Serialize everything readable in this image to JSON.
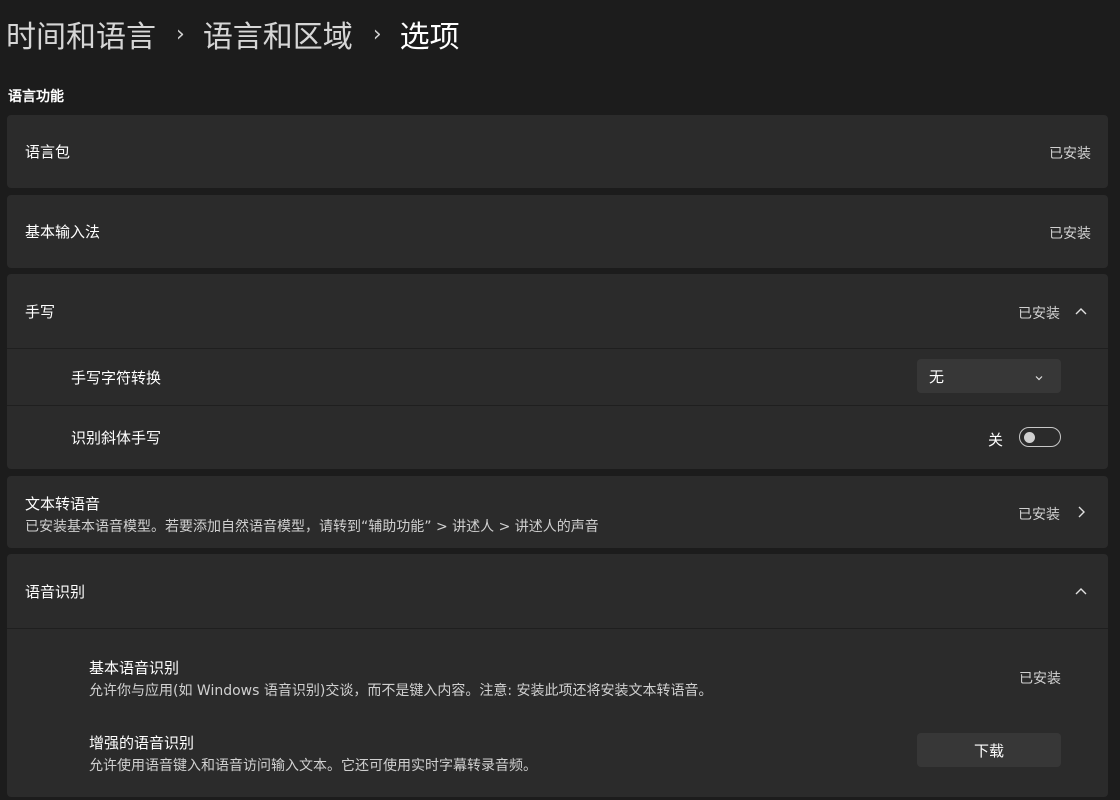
{
  "breadcrumb": {
    "items": [
      "时间和语言",
      "语言和区域",
      "选项"
    ],
    "separator": "›"
  },
  "section": {
    "title": "语言功能"
  },
  "language_pack": {
    "label": "语言包",
    "status": "已安装"
  },
  "basic_input": {
    "label": "基本输入法",
    "status": "已安装"
  },
  "handwriting": {
    "label": "手写",
    "status": "已安装",
    "expanded": true,
    "char_conversion": {
      "label": "手写字符转换",
      "selected": "无"
    },
    "cursive": {
      "label": "识别斜体手写",
      "toggle_text": "关",
      "on": false
    }
  },
  "text_to_speech": {
    "label": "文本转语音",
    "description": "已安装基本语音模型。若要添加自然语音模型，请转到“辅助功能” > 讲述人 > 讲述人的声音",
    "status": "已安装"
  },
  "speech_recognition": {
    "label": "语音识别",
    "expanded": true,
    "basic": {
      "label": "基本语音识别",
      "description": "允许你与应用(如 Windows 语音识别)交谈，而不是键入内容。注意: 安装此项还将安装文本转语音。",
      "status": "已安装"
    },
    "enhanced": {
      "label": "增强的语音识别",
      "description": "允许使用语音键入和语音访问输入文本。它还可使用实时字幕转录音频。",
      "button": "下载"
    }
  },
  "icons": {
    "chevron_up": "chevron-up-icon",
    "chevron_right": "chevron-right-icon",
    "chevron_down": "chevron-down-icon"
  },
  "colors": {
    "background": "#1c1c1c",
    "card": "#2b2b2b",
    "control": "#373737",
    "secondary_text": "#d0d0d0"
  }
}
